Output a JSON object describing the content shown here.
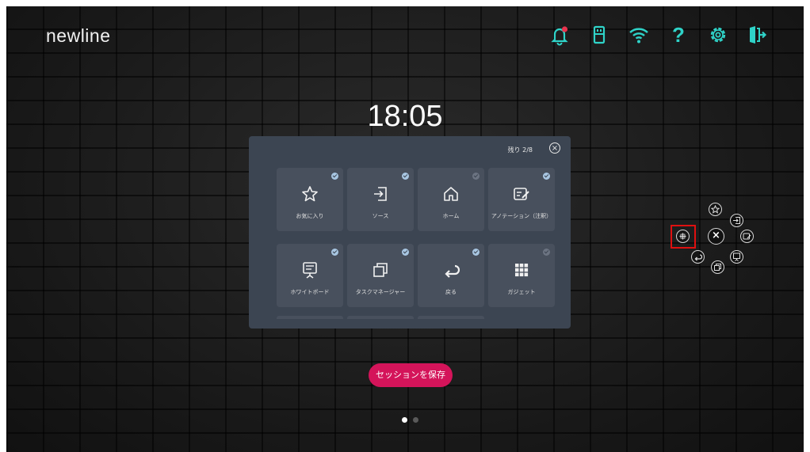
{
  "brand": {
    "logo_text": "newline"
  },
  "top_icons": [
    {
      "name": "notification-bell-icon"
    },
    {
      "name": "usb-icon"
    },
    {
      "name": "wifi-icon"
    },
    {
      "name": "help-icon",
      "glyph": "?"
    },
    {
      "name": "settings-icon"
    },
    {
      "name": "exit-icon"
    }
  ],
  "accent_color": "#2fd3c8",
  "clock": {
    "time": "18:05"
  },
  "panel": {
    "remaining_text": "残り 2/8",
    "close_glyph": "×",
    "tiles": [
      {
        "label": "お気に入り",
        "icon": "star-icon",
        "checked": true
      },
      {
        "label": "ソース",
        "icon": "source-input-icon",
        "checked": true
      },
      {
        "label": "ホーム",
        "icon": "home-icon",
        "checked": false
      },
      {
        "label": "アノテーション（注釈）",
        "icon": "annotation-icon",
        "checked": true
      },
      {
        "label": "ホワイトボード",
        "icon": "whiteboard-icon",
        "checked": true
      },
      {
        "label": "タスクマネージャー",
        "icon": "task-manager-icon",
        "checked": true
      },
      {
        "label": "戻る",
        "icon": "back-arrow-icon",
        "checked": true
      },
      {
        "label": "ガジェット",
        "icon": "gadget-grid-icon",
        "checked": false
      }
    ]
  },
  "save_session": {
    "label": "セッションを保存",
    "color": "#d4145a"
  },
  "pager": {
    "pages": 2,
    "current": 1
  },
  "floating_menu": {
    "close_glyph": "×",
    "items": [
      "star-icon",
      "source-input-icon",
      "annotation-icon",
      "whiteboard-icon",
      "task-manager-icon",
      "back-arrow-icon",
      "add-icon"
    ]
  }
}
